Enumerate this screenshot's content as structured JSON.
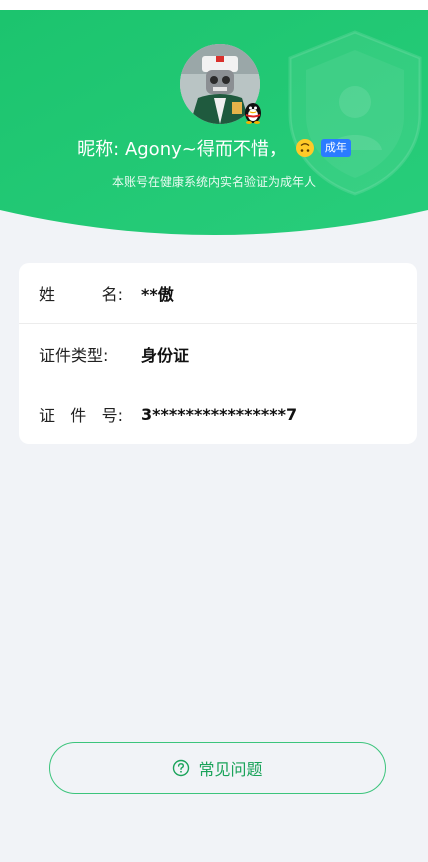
{
  "header": {
    "nickname": "昵称: Agony~得而不惜，",
    "emoji": "upside-down-face-emoji",
    "adult_badge": "成年",
    "verify_tip": "本账号在健康系统内实名验证为成年人"
  },
  "info": {
    "name_label": [
      "姓",
      "名:"
    ],
    "name_value": "**傲",
    "id_type_label": "证件类型:",
    "id_type_value": "身份证",
    "id_number_label": [
      "证",
      "件",
      "号:"
    ],
    "id_number_value": "3****************7"
  },
  "faq": {
    "label": "常见问题",
    "icon": "question-circle-icon"
  },
  "colors": {
    "header_green": "#1fc772",
    "header_green_light": "#2fd27f",
    "background": "#f1f3f7",
    "accent_green": "#3cc47c",
    "badge_blue": "#2b7bff"
  }
}
